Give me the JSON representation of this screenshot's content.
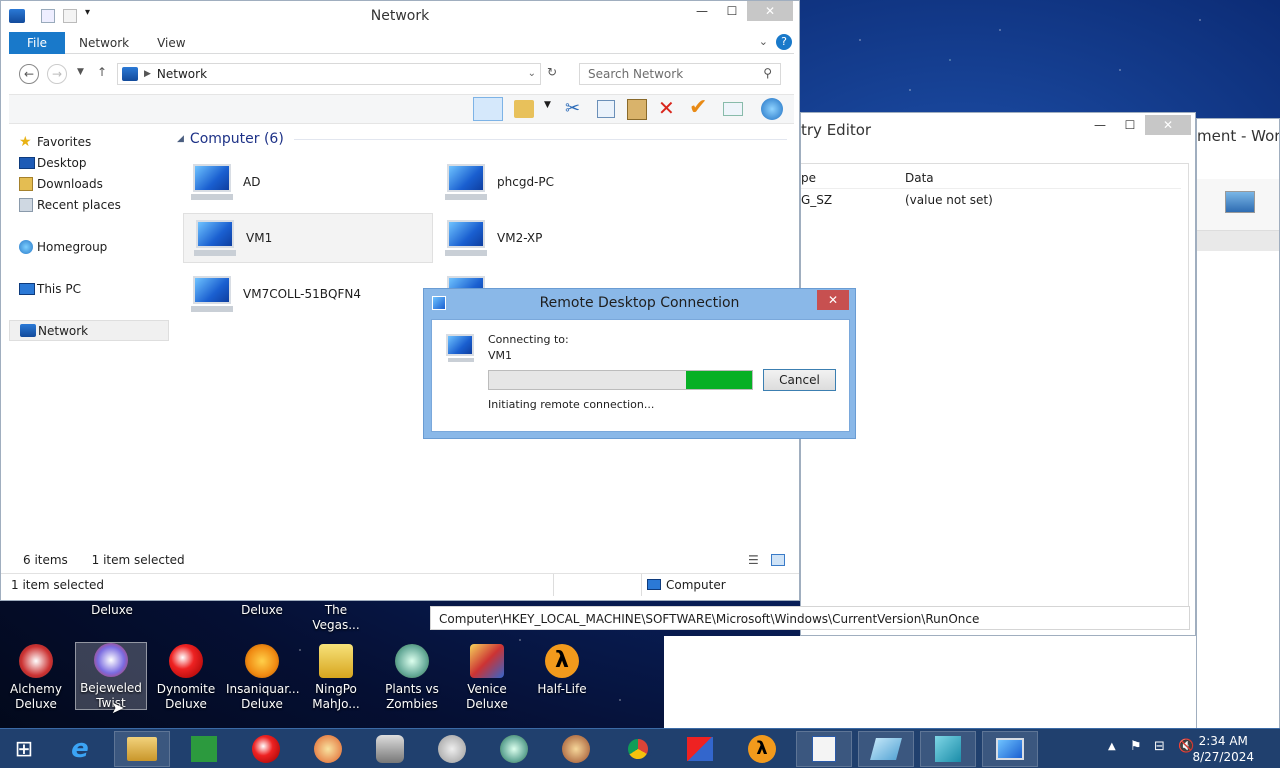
{
  "explorer": {
    "title": "Network",
    "ribbon_tabs": [
      "File",
      "Network",
      "View"
    ],
    "address": "Network",
    "search_placeholder": "Search Network",
    "nav": [
      "Favorites",
      "Desktop",
      "Downloads",
      "Recent places",
      "Homegroup",
      "This PC",
      "Network"
    ],
    "group_label": "Computer (6)",
    "computers": [
      "AD",
      "phcgd-PC",
      "VM1",
      "VM2-XP",
      "VM7COLL-51BQFN4"
    ],
    "status_items": "6 items",
    "status_selected": "1 item selected"
  },
  "registry": {
    "title": "try Editor",
    "col_type": "pe",
    "col_data": "Data",
    "row_type": "G_SZ",
    "row_data": "(value not set)",
    "status_left": "1 item selected",
    "status_right": "Computer",
    "path": "Computer\\HKEY_LOCAL_MACHINE\\SOFTWARE\\Microsoft\\Windows\\CurrentVersion\\RunOnce"
  },
  "word": {
    "title": "ment - Word"
  },
  "rdp": {
    "title": "Remote Desktop Connection",
    "connecting_label": "Connecting to:",
    "target": "VM1",
    "cancel": "Cancel",
    "status": "Initiating remote connection...",
    "progress": 0.25
  },
  "desktop": {
    "partial_labels": [
      "Deluxe",
      "Deluxe",
      "The Vegas..."
    ],
    "icons": [
      {
        "l1": "Alchemy",
        "l2": "Deluxe"
      },
      {
        "l1": "Bejeweled",
        "l2": "Twist"
      },
      {
        "l1": "Dynomite",
        "l2": "Deluxe"
      },
      {
        "l1": "Insaniquar...",
        "l2": "Deluxe"
      },
      {
        "l1": "NingPo",
        "l2": "MahJo..."
      },
      {
        "l1": "Plants vs",
        "l2": "Zombies"
      },
      {
        "l1": "Venice",
        "l2": "Deluxe"
      },
      {
        "l1": "Half-Life",
        "l2": ""
      }
    ]
  },
  "taskbar": {
    "time": "2:34 AM",
    "date": "8/27/2024"
  },
  "colors": {
    "accent": "#1979ca",
    "progress": "#06b025",
    "taskbar": "#20406e"
  }
}
